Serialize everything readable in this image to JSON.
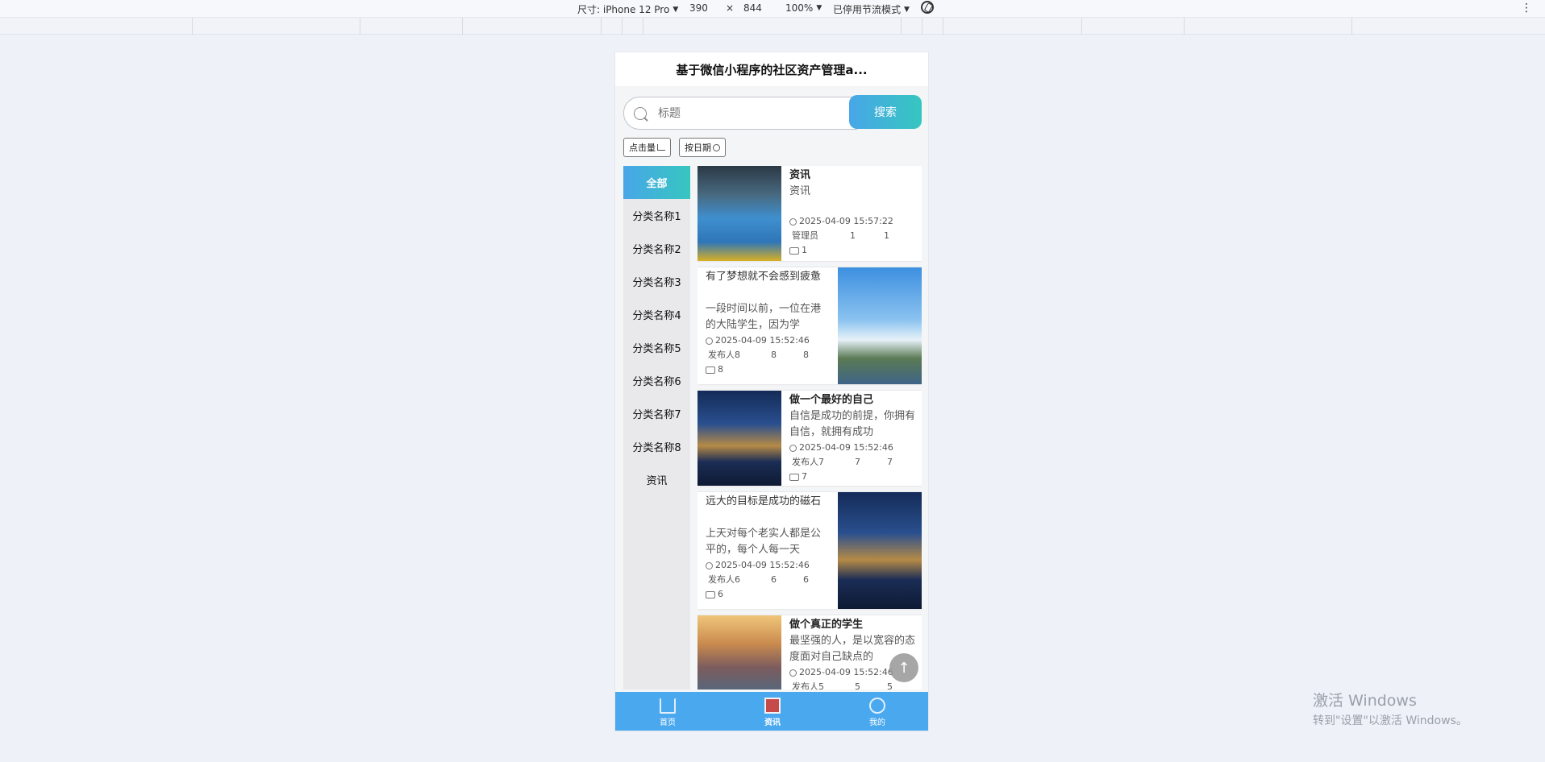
{
  "devtools": {
    "device_label": "尺寸: iPhone 12 Pro",
    "width": "390",
    "times": "×",
    "height": "844",
    "zoom": "100%",
    "throttle": "已停用节流模式",
    "more": "⋮"
  },
  "app": {
    "title": "基于微信小程序的社区资产管理a...",
    "search_placeholder": "标题",
    "search_button": "搜索",
    "sort_by_views": "点击量",
    "sort_by_date": "按日期"
  },
  "categories": [
    "全部",
    "分类名称1",
    "分类名称2",
    "分类名称3",
    "分类名称4",
    "分类名称5",
    "分类名称6",
    "分类名称7",
    "分类名称8",
    "资讯"
  ],
  "articles": [
    {
      "title": "资讯",
      "desc": "资讯",
      "date": "2025-04-09 15:57:22",
      "author": "管理员",
      "likes": "1",
      "favs": "1",
      "views": "1"
    },
    {
      "title": "有了梦想就不会感到疲惫",
      "desc": "一段时间以前，一位在港的大陆学生，因为学",
      "date": "2025-04-09 15:52:46",
      "author": "发布人8",
      "likes": "8",
      "favs": "8",
      "views": "8"
    },
    {
      "title": "做一个最好的自己",
      "desc": "自信是成功的前提，你拥有自信，就拥有成功",
      "date": "2025-04-09 15:52:46",
      "author": "发布人7",
      "likes": "7",
      "favs": "7",
      "views": "7"
    },
    {
      "title": "远大的目标是成功的磁石",
      "desc": "上天对每个老实人都是公平的，每个人每一天",
      "date": "2025-04-09 15:52:46",
      "author": "发布人6",
      "likes": "6",
      "favs": "6",
      "views": "6"
    },
    {
      "title": "做个真正的学生",
      "desc": "最坚强的人，是以宽容的态度面对自己缺点的",
      "date": "2025-04-09 15:52:46",
      "author": "发布人5",
      "likes": "5",
      "favs": "5",
      "views": ""
    }
  ],
  "tabbar": {
    "home": "首页",
    "news": "资讯",
    "mine": "我的"
  },
  "watermark": {
    "line1": "激活 Windows",
    "line2": "转到\"设置\"以激活 Windows。"
  }
}
